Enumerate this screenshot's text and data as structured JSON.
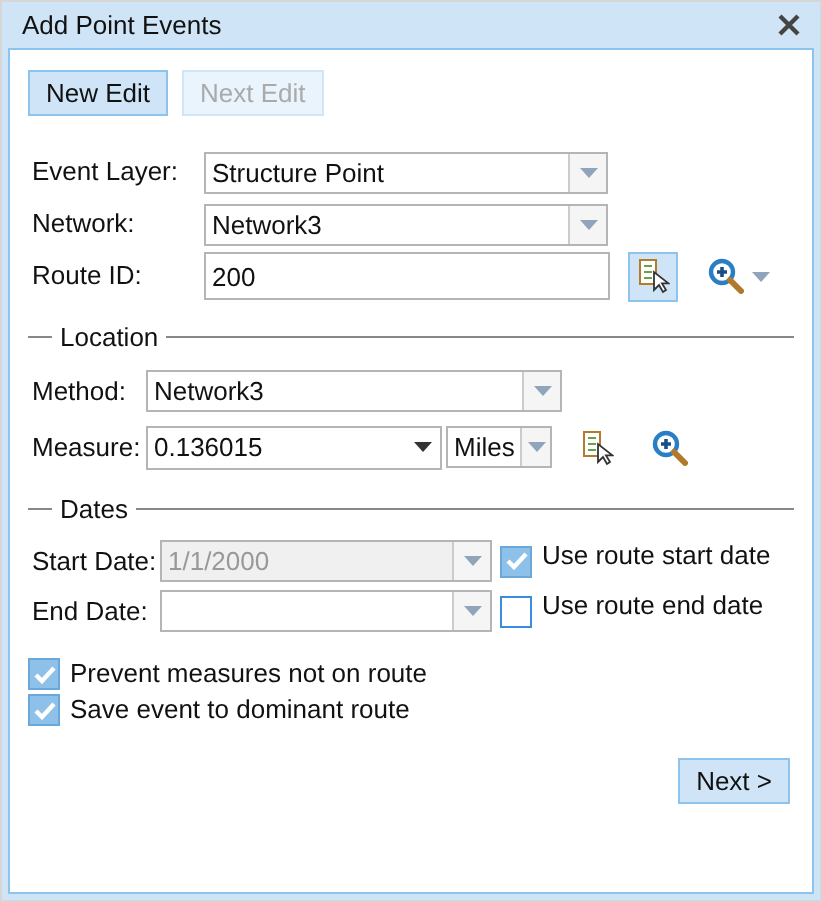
{
  "window": {
    "title": "Add Point Events"
  },
  "edit_buttons": [
    {
      "label": "New Edit",
      "disabled": false
    },
    {
      "label": "Next Edit",
      "disabled": true
    }
  ],
  "fields": [
    {
      "label": "Event Layer:",
      "value": "Structure Point",
      "kind": "combo"
    },
    {
      "label": "Network:",
      "value": "Network3",
      "kind": "combo"
    },
    {
      "label": "Route ID:",
      "value": "200",
      "kind": "text"
    }
  ],
  "location": {
    "title": "Location",
    "method": {
      "label": "Method:",
      "value": "Network3"
    },
    "measure": {
      "label": "Measure:",
      "value": "0.136015",
      "units": "Miles"
    }
  },
  "dates": {
    "title": "Dates",
    "rows": [
      {
        "label": "Start Date:",
        "value": "1/1/2000",
        "disabled": true,
        "option": {
          "label": "Use route start date",
          "checked": true
        }
      },
      {
        "label": "End Date:",
        "disabled": false,
        "option": {
          "label": "Use route end date",
          "checked": false
        }
      }
    ]
  },
  "options": [
    {
      "label": "Prevent measures not on route",
      "checked": true
    },
    {
      "label": "Save event to dominant route",
      "checked": true
    }
  ],
  "next_button": {
    "label": "Next >"
  }
}
